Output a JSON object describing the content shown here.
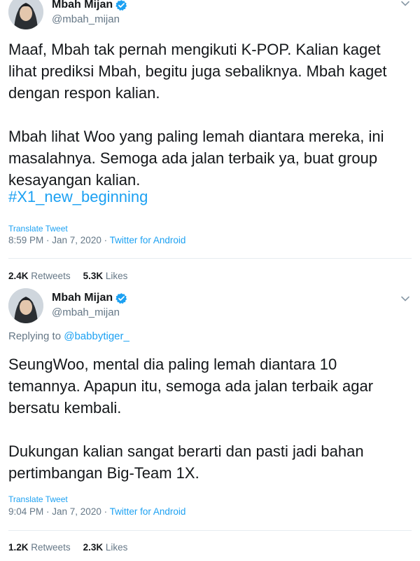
{
  "tweets": [
    {
      "author_name": "Mbah Mijan",
      "handle": "@mbah_mijan",
      "replying_prefix": "",
      "replying_to": "",
      "text": "Maaf, Mbah tak pernah mengikuti K-POP. Kalian kaget\nlihat prediksi Mbah, begitu juga sebaliknya. Mbah kaget\ndengan respon kalian.\n\nMbah lihat Woo yang paling lemah diantara mereka, ini\nmasalahnya. Semoga ada jalan terbaik ya, buat group\nkesayangan kalian.",
      "hashtag": "#X1_new_beginning",
      "translate_label": "Translate Tweet",
      "timestamp": "8:59 PM · Jan 7, 2020 · ",
      "source": "Twitter for Android",
      "retweets": "2.4K",
      "retweets_label": "Retweets",
      "likes": "5.3K",
      "likes_label": "Likes"
    },
    {
      "author_name": "Mbah Mijan",
      "handle": "@mbah_mijan",
      "replying_prefix": "Replying to ",
      "replying_to": "@babbytiger_",
      "text": "SeungWoo, mental dia paling lemah diantara 10\ntemannya. Apapun itu, semoga ada jalan terbaik agar\nbersatu kembali.\n\nDukungan kalian sangat berarti dan pasti jadi bahan\npertimbangan Big-Team 1X.",
      "hashtag": "",
      "translate_label": "Translate Tweet",
      "timestamp": "9:04 PM · Jan 7, 2020 · ",
      "source": "Twitter for Android",
      "retweets": "1.2K",
      "retweets_label": "Retweets",
      "likes": "2.3K",
      "likes_label": "Likes"
    }
  ],
  "colors": {
    "link": "#1da1f2",
    "muted": "#657786",
    "text": "#14171a",
    "divider": "#e6ecf0"
  },
  "icons": [
    "avatar",
    "verified-badge-icon",
    "chevron-down-icon"
  ]
}
